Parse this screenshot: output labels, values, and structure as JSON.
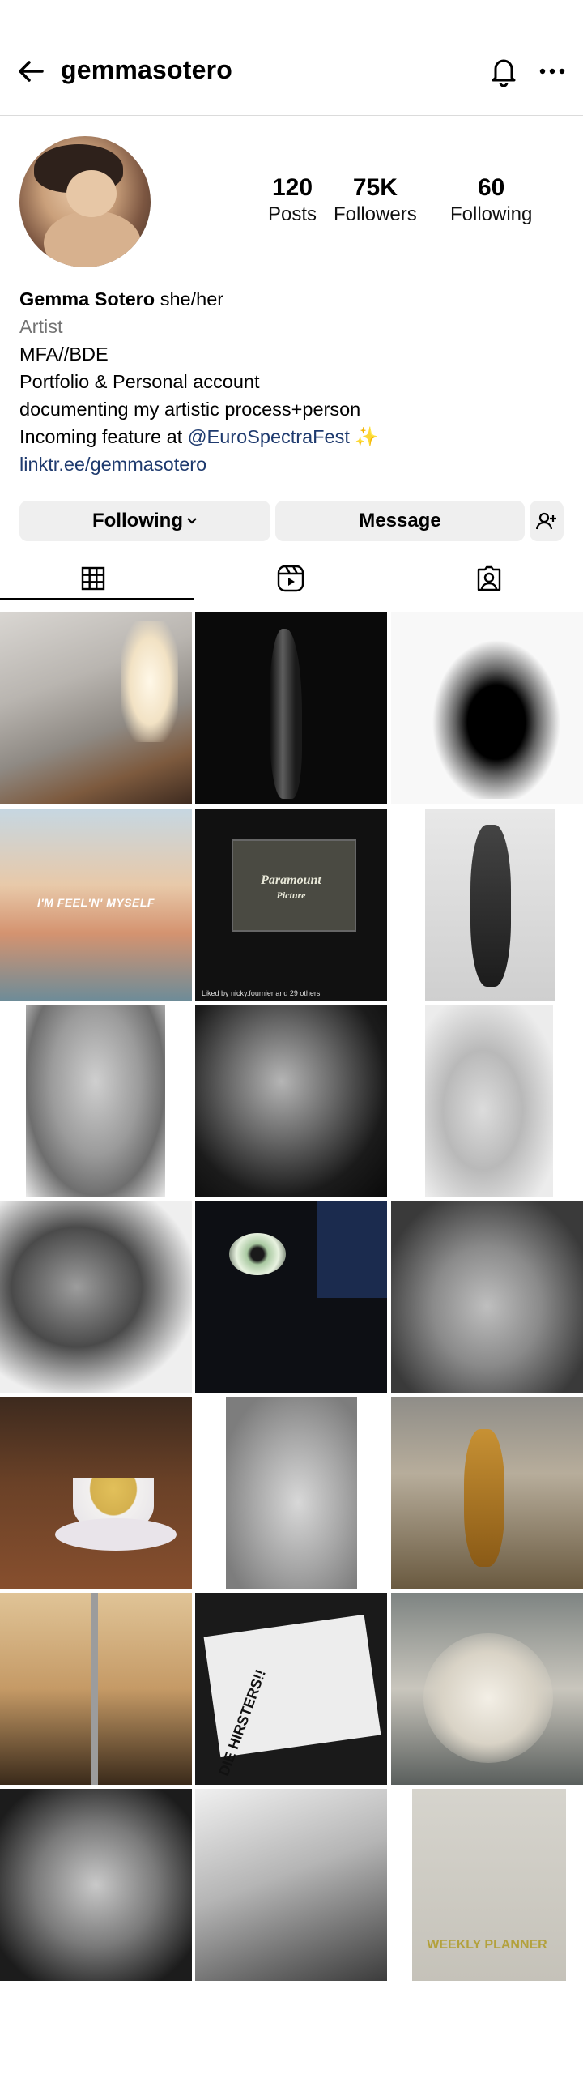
{
  "header": {
    "username": "gemmasotero",
    "back_icon": "arrow-left-icon",
    "notification_icon": "bell-icon",
    "more_icon": "more-horizontal-icon"
  },
  "profile": {
    "stats": [
      {
        "value": "120",
        "label": "Posts"
      },
      {
        "value": "75K",
        "label": "Followers"
      },
      {
        "value": "60",
        "label": "Following"
      }
    ],
    "name": "Gemma Sotero",
    "pronouns": "she/her",
    "category": "Artist",
    "bio_lines": [
      "MFA//BDE",
      "Portfolio & Personal account",
      "documenting my artistic process+person"
    ],
    "feature_prefix": "Incoming feature at ",
    "feature_mention": "@EuroSpectraFest",
    "feature_emoji": "✨",
    "link": "linktr.ee/gemmasotero"
  },
  "actions": {
    "following_label": "Following",
    "message_label": "Message"
  },
  "tabs": [
    {
      "name": "posts",
      "icon": "grid-icon"
    },
    {
      "name": "reels",
      "icon": "reels-icon"
    },
    {
      "name": "tagged",
      "icon": "tagged-person-icon"
    }
  ],
  "grid_text": {
    "post4_overlay": "I'M FEEL'N' MYSELF",
    "post5_logo": "Paramount",
    "post5_logo_sub": "Picture",
    "post5_caption": "Liked by nicky.fournier and 29 others",
    "post14_text": "DIE HIRSTERS!!",
    "post21_text": "WEEKLY PLANNER"
  },
  "colors": {
    "button_bg": "#efefef",
    "link_color": "#1e3a6e",
    "muted_text": "#737373",
    "divider": "#dbdbdb"
  }
}
